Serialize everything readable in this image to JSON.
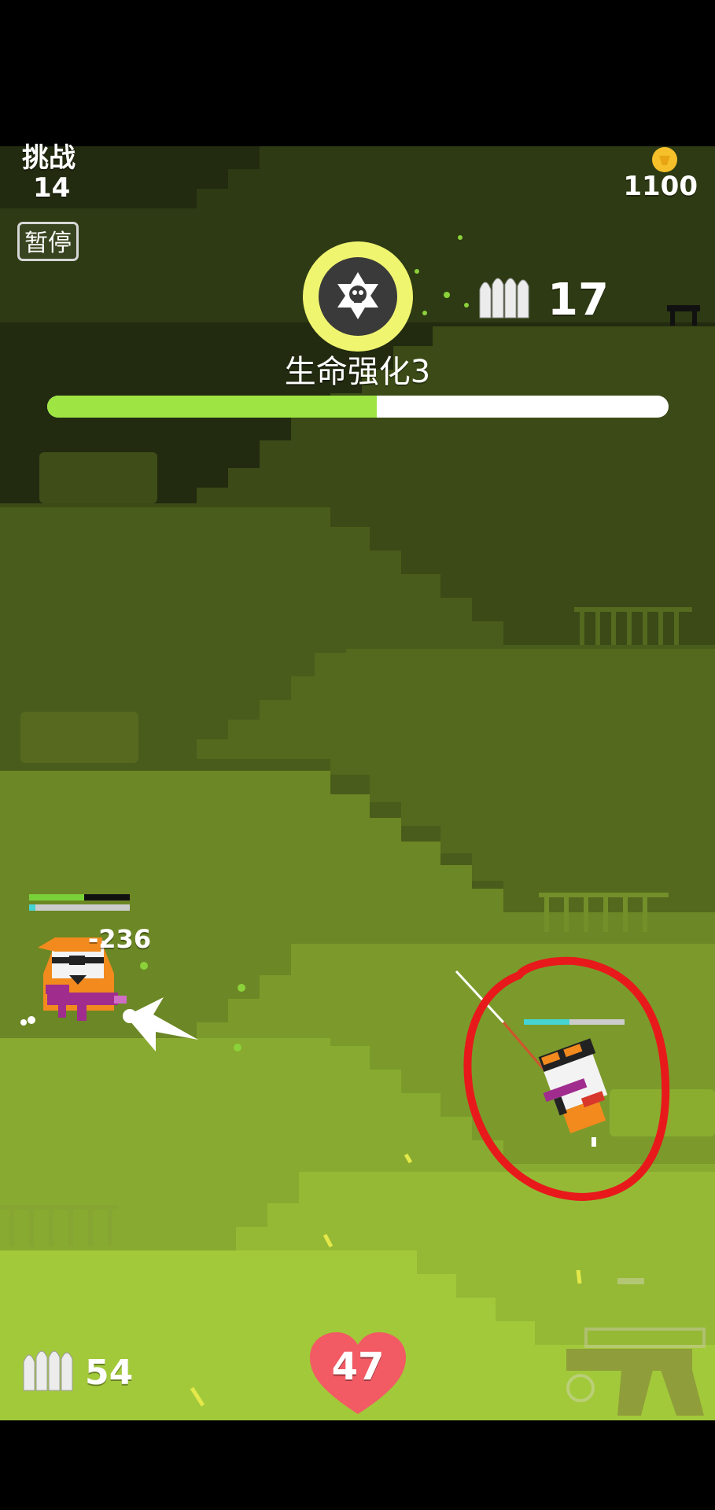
{
  "hud": {
    "challenge_label": "挑战",
    "challenge_level": "14",
    "coin_count": "1100",
    "pause_label": "暂停",
    "wave_ammo_count": "17",
    "upgrade_label": "生命强化3",
    "upgrade_progress": 0.53,
    "ammo_count": "54",
    "health": "47"
  },
  "combat": {
    "damage_number": "-236"
  },
  "colors": {
    "coin": "#f5c02a",
    "upgrade_ring": "#f0f570",
    "progress_fill": "#9ee544",
    "heart": "#f25a64",
    "annotation_circle": "#e8191b",
    "enemy_body": "#f28a1e",
    "gun": "#a02c8e"
  },
  "icons": {
    "upgrade": "skull-star-icon",
    "coin": "coin-icon",
    "ammo": "bullets-icon",
    "health": "heart-icon",
    "weapon": "rifle-icon"
  }
}
